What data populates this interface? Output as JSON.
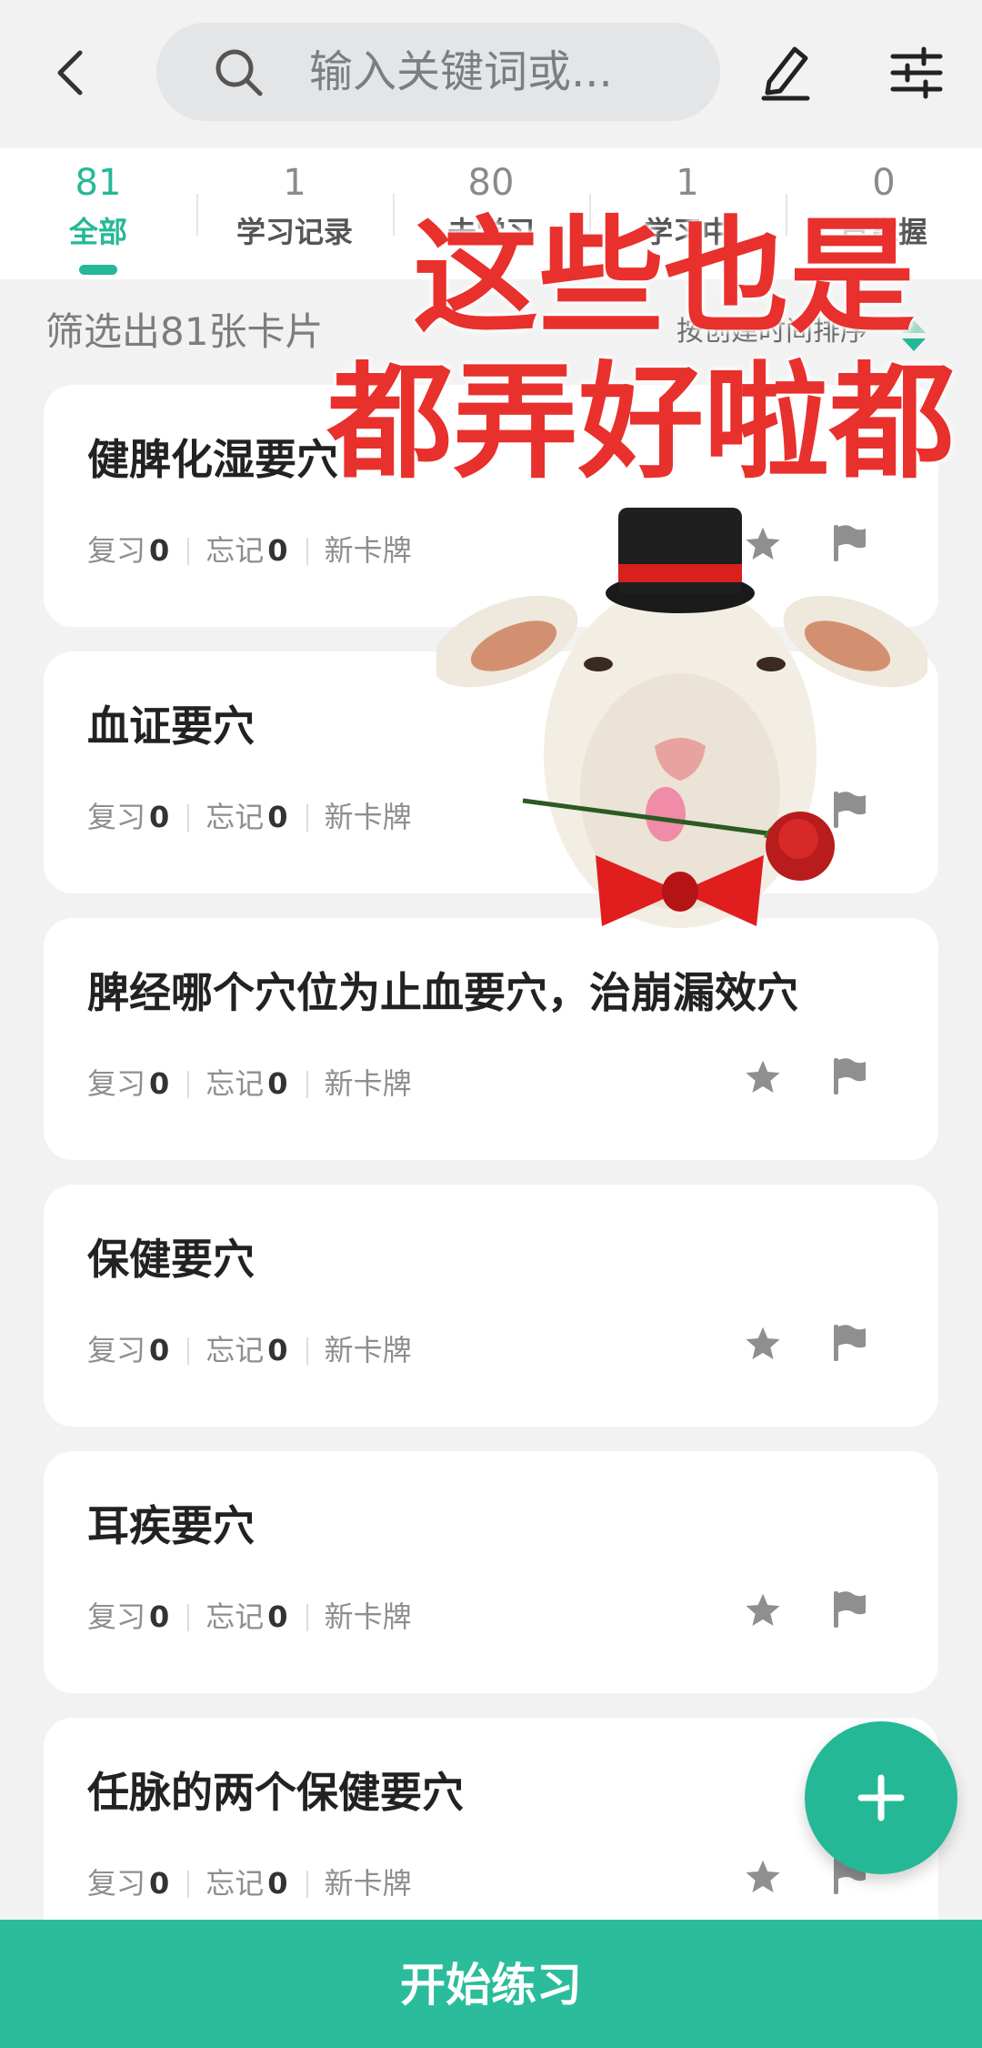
{
  "header": {
    "search_placeholder": "输入关键词或...",
    "icons": [
      "back-icon",
      "search-icon",
      "edit-icon",
      "filter-icon"
    ]
  },
  "tabs": [
    {
      "count": "81",
      "label": "全部",
      "active": true
    },
    {
      "count": "1",
      "label": "学习记录"
    },
    {
      "count": "80",
      "label": "未学习"
    },
    {
      "count": "1",
      "label": "学习中"
    },
    {
      "count": "0",
      "label": "已掌握"
    }
  ],
  "summary": "筛选出81张卡片",
  "sort_label": "按创建时间排序",
  "overlay": {
    "line1": "这些也是",
    "line2": "都弄好啦都"
  },
  "stat_labels": {
    "review": "复习",
    "forget": "忘记"
  },
  "cards": [
    {
      "title": "健脾化湿要穴",
      "review": "0",
      "forget": "0",
      "tag": "新卡牌"
    },
    {
      "title": "血证要穴",
      "review": "0",
      "forget": "0",
      "tag": "新卡牌"
    },
    {
      "title": "脾经哪个穴位为止血要穴，治崩漏效穴",
      "review": "0",
      "forget": "0",
      "tag": "新卡牌"
    },
    {
      "title": "保健要穴",
      "review": "0",
      "forget": "0",
      "tag": "新卡牌"
    },
    {
      "title": "耳疾要穴",
      "review": "0",
      "forget": "0",
      "tag": "新卡牌"
    },
    {
      "title": "任脉的两个保健要穴",
      "review": "0",
      "forget": "0",
      "tag": "新卡牌"
    }
  ],
  "start_button": "开始练习",
  "colors": {
    "accent": "#25b896",
    "overlay_text": "#e8302c"
  }
}
